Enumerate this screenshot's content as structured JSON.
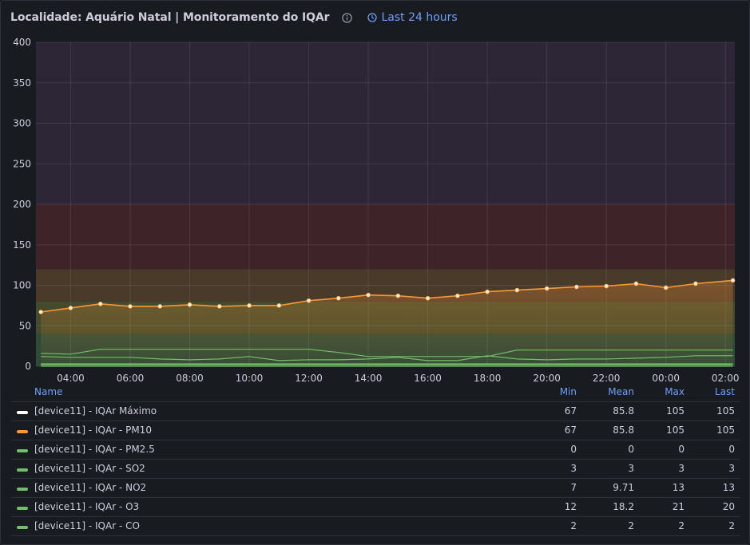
{
  "panel": {
    "title": "Localidade: Aquário Natal | Monitoramento do IQAr",
    "time_range": "Last 24 hours"
  },
  "chart_data": {
    "type": "line",
    "ylim": [
      0,
      400
    ],
    "y_ticks": [
      "0",
      "50",
      "100",
      "150",
      "200",
      "250",
      "300",
      "350",
      "400"
    ],
    "x_ticks": [
      "04:00",
      "06:00",
      "08:00",
      "10:00",
      "12:00",
      "14:00",
      "16:00",
      "18:00",
      "20:00",
      "22:00",
      "00:00",
      "02:00"
    ],
    "x": [
      "03:00",
      "04:00",
      "05:00",
      "06:00",
      "07:00",
      "08:00",
      "09:00",
      "10:00",
      "11:00",
      "12:00",
      "13:00",
      "14:00",
      "15:00",
      "16:00",
      "17:00",
      "18:00",
      "19:00",
      "20:00",
      "21:00",
      "22:00",
      "23:00",
      "00:00",
      "01:00",
      "02:15"
    ],
    "thresholds": [
      {
        "from": 0,
        "to": 40,
        "color": "#2f4a37"
      },
      {
        "from": 40,
        "to": 80,
        "color": "#444a2e"
      },
      {
        "from": 80,
        "to": 120,
        "color": "#4a3a2a"
      },
      {
        "from": 120,
        "to": 200,
        "color": "#3e2428"
      },
      {
        "from": 200,
        "to": 400,
        "color": "#2d2636"
      }
    ],
    "series": [
      {
        "name": "[device11] - IQAr Máximo",
        "color": "#ffffff",
        "values": [
          67,
          72,
          77,
          74,
          74,
          76,
          74,
          75,
          75,
          81,
          84,
          88,
          87,
          84,
          87,
          92,
          94,
          96,
          98,
          99,
          102,
          97,
          102,
          106
        ]
      },
      {
        "name": "[device11] - IQAr - PM10",
        "color": "#ff9830",
        "values": [
          67,
          72,
          77,
          74,
          74,
          76,
          74,
          75,
          75,
          81,
          84,
          88,
          87,
          84,
          87,
          92,
          94,
          96,
          98,
          99,
          102,
          97,
          102,
          106
        ]
      },
      {
        "name": "[device11] - IQAr - PM2.5",
        "color": "#73bf69",
        "values": [
          0,
          0,
          0,
          0,
          0,
          0,
          0,
          0,
          0,
          0,
          0,
          0,
          0,
          0,
          0,
          0,
          0,
          0,
          0,
          0,
          0,
          0,
          0,
          0
        ]
      },
      {
        "name": "[device11] - IQAr - SO2",
        "color": "#73bf69",
        "values": [
          3,
          3,
          3,
          3,
          3,
          3,
          3,
          3,
          3,
          3,
          3,
          3,
          3,
          3,
          3,
          3,
          3,
          3,
          3,
          3,
          3,
          3,
          3,
          3
        ]
      },
      {
        "name": "[device11] - IQAr - NO2",
        "color": "#73bf69",
        "values": [
          12,
          11,
          11,
          11,
          9,
          8,
          9,
          12,
          7,
          8,
          8,
          9,
          11,
          7,
          7,
          13,
          9,
          8,
          9,
          9,
          10,
          11,
          13,
          13
        ]
      },
      {
        "name": "[device11] - IQAr - O3",
        "color": "#73bf69",
        "values": [
          16,
          15,
          21,
          21,
          21,
          21,
          21,
          21,
          21,
          21,
          17,
          12,
          12,
          12,
          12,
          12,
          20,
          20,
          20,
          20,
          20,
          20,
          20,
          20
        ]
      },
      {
        "name": "[device11] - IQAr - CO",
        "color": "#73bf69",
        "values": [
          2,
          2,
          2,
          2,
          2,
          2,
          2,
          2,
          2,
          2,
          2,
          2,
          2,
          2,
          2,
          2,
          2,
          2,
          2,
          2,
          2,
          2,
          2,
          2
        ]
      }
    ]
  },
  "legend": {
    "headers": {
      "name": "Name",
      "min": "Min",
      "mean": "Mean",
      "max": "Max",
      "last": "Last"
    },
    "rows": [
      {
        "name": "[device11] - IQAr Máximo",
        "color": "#ffffff",
        "min": "67",
        "mean": "85.8",
        "max": "105",
        "last": "105"
      },
      {
        "name": "[device11] - IQAr - PM10",
        "color": "#ff9830",
        "min": "67",
        "mean": "85.8",
        "max": "105",
        "last": "105"
      },
      {
        "name": "[device11] - IQAr - PM2.5",
        "color": "#73bf69",
        "min": "0",
        "mean": "0",
        "max": "0",
        "last": "0"
      },
      {
        "name": "[device11] - IQAr - SO2",
        "color": "#73bf69",
        "min": "3",
        "mean": "3",
        "max": "3",
        "last": "3"
      },
      {
        "name": "[device11] - IQAr - NO2",
        "color": "#73bf69",
        "min": "7",
        "mean": "9.71",
        "max": "13",
        "last": "13"
      },
      {
        "name": "[device11] - IQAr - O3",
        "color": "#73bf69",
        "min": "12",
        "mean": "18.2",
        "max": "21",
        "last": "20"
      },
      {
        "name": "[device11] - IQAr - CO",
        "color": "#73bf69",
        "min": "2",
        "mean": "2",
        "max": "2",
        "last": "2"
      }
    ]
  }
}
